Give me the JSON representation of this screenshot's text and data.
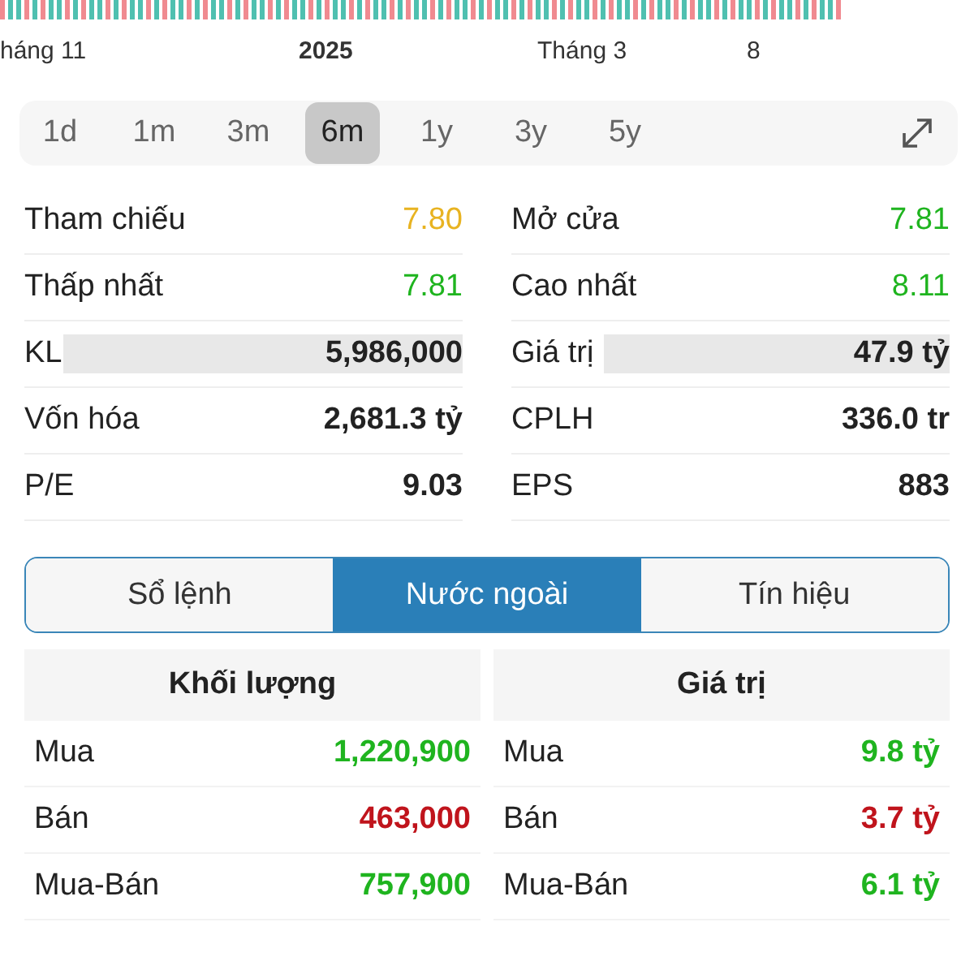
{
  "chart": {
    "axis_labels": [
      {
        "text": "háng 11",
        "bold": false
      },
      {
        "text": "2025",
        "bold": true
      },
      {
        "text": "Tháng 3",
        "bold": false
      },
      {
        "text": "8",
        "bold": false
      }
    ]
  },
  "ranges": [
    {
      "label": "1d",
      "selected": false
    },
    {
      "label": "1m",
      "selected": false
    },
    {
      "label": "3m",
      "selected": false
    },
    {
      "label": "6m",
      "selected": true
    },
    {
      "label": "1y",
      "selected": false
    },
    {
      "label": "3y",
      "selected": false
    },
    {
      "label": "5y",
      "selected": false
    }
  ],
  "stats": [
    [
      {
        "label": "Tham chiếu",
        "value": "7.80",
        "color": "#e8b321"
      },
      {
        "label": "Mở cửa",
        "value": "7.81",
        "color": "#1fb41f"
      }
    ],
    [
      {
        "label": "Thấp nhất",
        "value": "7.81",
        "color": "#1fb41f"
      },
      {
        "label": "Cao nhất",
        "value": "8.11",
        "color": "#1fb41f"
      }
    ],
    [
      {
        "label": "KL",
        "value": "5,986,000",
        "color": "#222222",
        "level": 0.91
      },
      {
        "label": "Giá trị",
        "value": "47.9 tỷ",
        "color": "#222222",
        "level": 0.79
      }
    ],
    [
      {
        "label": "Vốn hóa",
        "value": "2,681.3 tỷ",
        "color": "#222222"
      },
      {
        "label": "CPLH",
        "value": "336.0 tr",
        "color": "#222222"
      }
    ],
    [
      {
        "label": "P/E",
        "value": "9.03",
        "color": "#222222"
      },
      {
        "label": "EPS",
        "value": "883",
        "color": "#222222"
      }
    ]
  ],
  "tabs": [
    {
      "label": "Sổ lệnh",
      "selected": false
    },
    {
      "label": "Nước ngoài",
      "selected": true
    },
    {
      "label": "Tín hiệu",
      "selected": false
    }
  ],
  "tables": [
    {
      "header": "Khối lượng",
      "rows": [
        {
          "label": "Mua",
          "value": "1,220,900",
          "color": "#1fb41f"
        },
        {
          "label": "Bán",
          "value": "463,000",
          "color": "#c0141c"
        },
        {
          "label": "Mua-Bán",
          "value": "757,900",
          "color": "#1fb41f"
        }
      ]
    },
    {
      "header": "Giá trị",
      "rows": [
        {
          "label": "Mua",
          "value": "9.8 tỷ",
          "color": "#1fb41f"
        },
        {
          "label": "Bán",
          "value": "3.7 tỷ",
          "color": "#c0141c"
        },
        {
          "label": "Mua-Bán",
          "value": "6.1 tỷ",
          "color": "#1fb41f"
        }
      ]
    }
  ]
}
